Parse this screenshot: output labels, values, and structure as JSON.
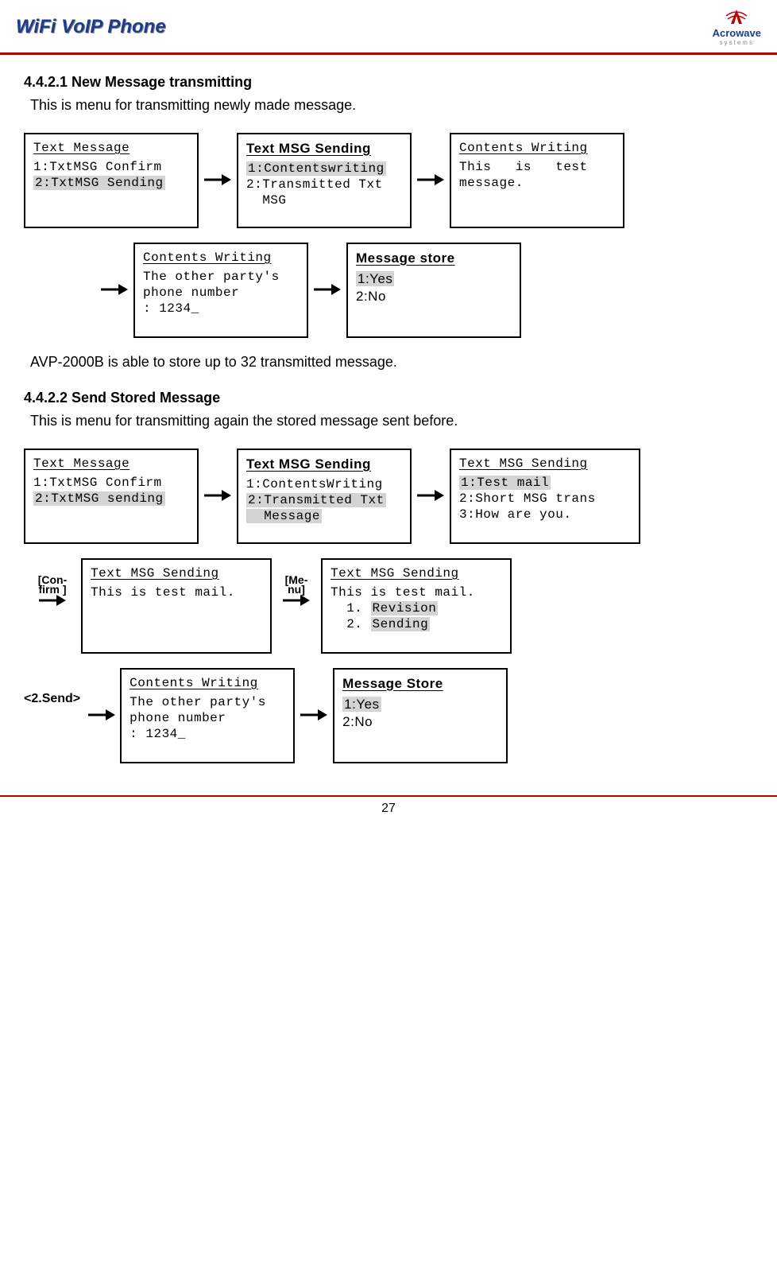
{
  "header": {
    "title": "WiFi VoIP Phone",
    "brand_top": "Acrowave",
    "brand_sub": "systems"
  },
  "sec4421": {
    "heading": "4.4.2.1 New Message transmitting",
    "intro": "This is menu for transmitting newly made message.",
    "row1": {
      "box1": {
        "title": "Text Message",
        "l1": "1:TxtMSG Confirm",
        "l2": "2:TxtMSG Sending"
      },
      "box2": {
        "title": "Text MSG Sending",
        "l1": "1:Contentswriting",
        "l2a": "2:Transmitted Txt",
        "l2b": "  MSG"
      },
      "box3": {
        "title": "Contents Writing",
        "body_a": "This   is   test",
        "body_b": "message."
      }
    },
    "row2": {
      "box1": {
        "title": "Contents Writing",
        "l1": "The other party's",
        "l2": "phone number",
        "l3": ": 1234_"
      },
      "box2": {
        "title": "Message store",
        "l1": "1:Yes",
        "l2": "2:No"
      }
    },
    "note": "AVP-2000B is able to store up to 32 transmitted message."
  },
  "sec4422": {
    "heading": "4.4.2.2 Send Stored Message",
    "intro": "This is menu for transmitting again the stored message sent before.",
    "row1": {
      "box1": {
        "title": "Text Message",
        "l1": "1:TxtMSG Confirm",
        "l2": "2:TxtMSG sending"
      },
      "box2": {
        "title": "Text MSG Sending",
        "l1": "1:ContentsWriting",
        "l2a": "2:Transmitted Txt",
        "l2b": "  Message"
      },
      "box3": {
        "title": "Text MSG Sending",
        "l1": "1:Test mail",
        "l2": "2:Short MSG trans",
        "l3": "3:How are you."
      }
    },
    "row2": {
      "label1a": "[Con-",
      "label1b": "firm ]",
      "box1": {
        "title": "Text MSG Sending",
        "l1": "This is test mail."
      },
      "label2a": "[Me-",
      "label2b": "nu]",
      "box2": {
        "title": "Text MSG Sending",
        "l1": "This is test mail.",
        "l2a": "  1. ",
        "l2b": "Revision",
        "l3a": "  2. ",
        "l3b": "Sending"
      }
    },
    "row3": {
      "label": "<2.Send>",
      "box1": {
        "title": "Contents Writing",
        "l1": "The other party's",
        "l2": "phone number",
        "l3": ": 1234_"
      },
      "box2": {
        "title": "Message Store",
        "l1": "1:Yes",
        "l2": "2:No"
      }
    }
  },
  "page_number": "27"
}
